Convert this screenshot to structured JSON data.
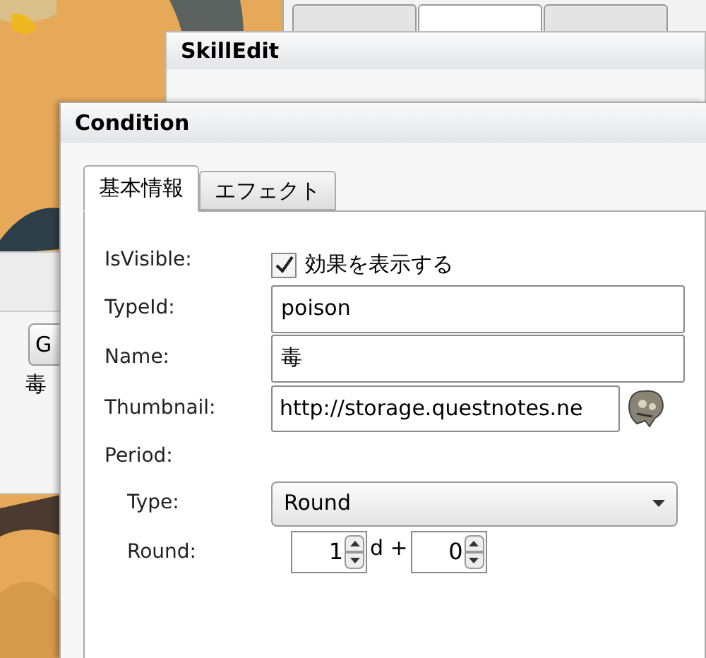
{
  "back_window": {
    "tabs": [
      {
        "selected": false
      },
      {
        "selected": true
      },
      {
        "selected": false
      }
    ]
  },
  "skill_window": {
    "title": "SkillEdit"
  },
  "left_panel": {
    "button": "G",
    "text": "毒"
  },
  "condition_window": {
    "title": "Condition",
    "tabs": [
      {
        "label": "基本情報",
        "selected": true
      },
      {
        "label": "エフェクト",
        "selected": false
      }
    ],
    "fields": [
      {
        "kind": "checkbox",
        "label": "IsVisible:",
        "text": "効果を表示する",
        "checked": true
      },
      {
        "kind": "text",
        "label": "TypeId:",
        "value": "poison"
      },
      {
        "kind": "text",
        "label": "Name:",
        "value": "毒"
      },
      {
        "kind": "thumbnail",
        "label": "Thumbnail:",
        "value": "http://storage.questnotes.ne"
      },
      {
        "kind": "heading",
        "label": "Period:"
      },
      {
        "kind": "select",
        "label": "Type:",
        "value": "Round"
      },
      {
        "kind": "round",
        "label": "Round:",
        "dice": "1",
        "separator": "d +",
        "bonus": "0"
      }
    ]
  }
}
